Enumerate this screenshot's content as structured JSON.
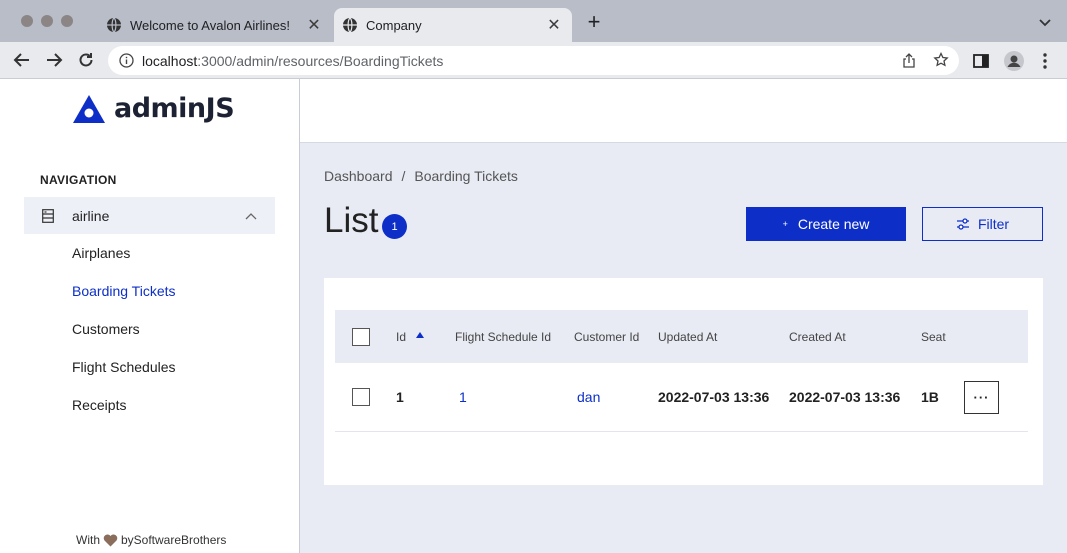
{
  "browser": {
    "tabs": [
      {
        "title": "Welcome to Avalon Airlines!",
        "icon": "globe-icon",
        "active": false
      },
      {
        "title": "Company",
        "icon": "globe-icon",
        "active": true
      }
    ],
    "url_host": "localhost",
    "url_path": ":3000/admin/resources/BoardingTickets"
  },
  "sidebar": {
    "logo_text": "adminJS",
    "nav_header": "NAVIGATION",
    "parent_label": "airline",
    "items": [
      {
        "label": "Airplanes",
        "active": false
      },
      {
        "label": "Boarding Tickets",
        "active": true
      },
      {
        "label": "Customers",
        "active": false
      },
      {
        "label": "Flight Schedules",
        "active": false
      },
      {
        "label": "Receipts",
        "active": false
      }
    ],
    "footer_prefix": "With",
    "footer_suffix": "bySoftwareBrothers"
  },
  "main": {
    "breadcrumb": [
      "Dashboard",
      "/",
      "Boarding Tickets"
    ],
    "title": "List",
    "count": "1",
    "create_label": "Create new",
    "filter_label": "Filter",
    "columns": [
      "Id",
      "Flight Schedule Id",
      "Customer Id",
      "Updated At",
      "Created At",
      "Seat"
    ],
    "rows": [
      {
        "id": "1",
        "flight_schedule_id": "1",
        "customer_id": "dan",
        "updated_at": "2022-07-03 13:36",
        "created_at": "2022-07-03 13:36",
        "seat": "1B",
        "actions": "···"
      }
    ]
  },
  "colors": {
    "accent": "#0d2fc8",
    "background": "#e8ebf4",
    "heart": "#8b6d5c"
  }
}
